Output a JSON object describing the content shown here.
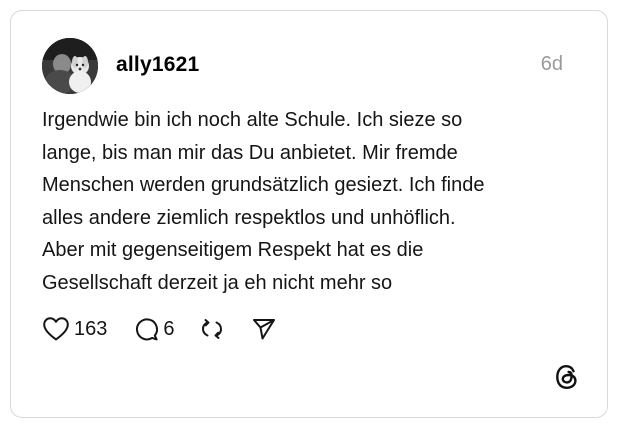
{
  "post": {
    "author": {
      "username": "ally1621"
    },
    "timestamp": "6d",
    "text_lines": [
      "Irgendwie bin ich noch alte Schule. Ich sieze so",
      "lange, bis man mir das Du anbietet. Mir fremde",
      "Menschen werden grundsätzlich gesiezt. Ich finde",
      "alles andere ziemlich respektlos und unhöflich.",
      "Aber mit gegenseitigem Respekt hat es die",
      "Gesellschaft derzeit ja eh nicht mehr so"
    ],
    "actions": {
      "like": {
        "icon": "heart-icon",
        "count": "163"
      },
      "reply": {
        "icon": "speech-bubble-icon",
        "count": "6"
      },
      "repost": {
        "icon": "repost-icon"
      },
      "share": {
        "icon": "send-icon"
      }
    }
  },
  "branding": {
    "logo": "threads-logo-icon"
  },
  "colors": {
    "text": "#151515",
    "muted": "#9a9a9a",
    "border": "#d9d9d9",
    "background": "#ffffff"
  }
}
